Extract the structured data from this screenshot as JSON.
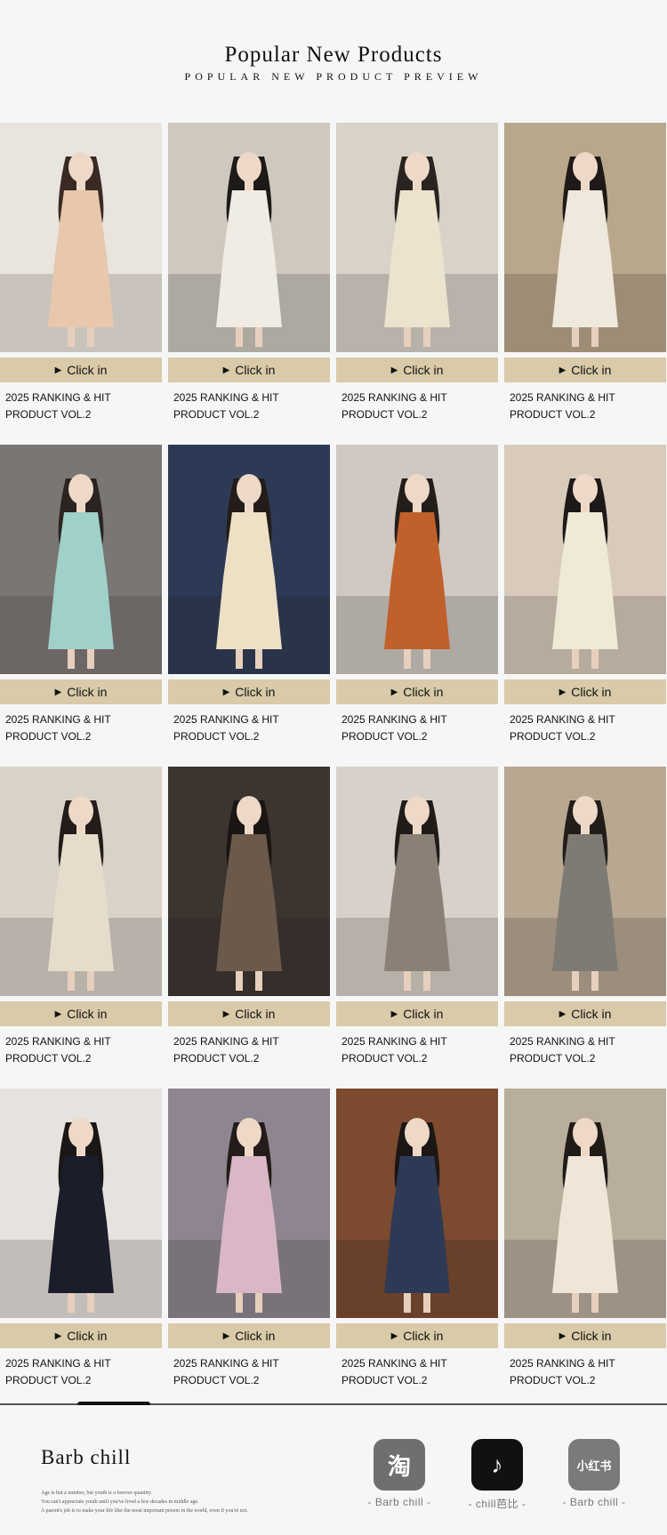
{
  "header": {
    "title": "Popular New Products",
    "subtitle": "POPULAR NEW PRODUCT PREVIEW"
  },
  "grid": {
    "button_label": "Click in",
    "items": [
      {
        "caption": "2025 RANKING & HIT PRODUCT VOL.2",
        "palette": [
          "#e9e4de",
          "#e8c7ac",
          "#3a2a24"
        ]
      },
      {
        "caption": "2025 RANKING & HIT PRODUCT VOL.2",
        "palette": [
          "#cfc8bf",
          "#f1ece3",
          "#1d1a18"
        ]
      },
      {
        "caption": "2025 RANKING & HIT PRODUCT VOL.2",
        "palette": [
          "#d8d2c8",
          "#ece3cf",
          "#2a2420"
        ]
      },
      {
        "caption": "2025 RANKING & HIT PRODUCT VOL.2",
        "palette": [
          "#b9a78c",
          "#efe8dc",
          "#1f1a17"
        ]
      },
      {
        "caption": "2025 RANKING & HIT PRODUCT VOL.2",
        "palette": [
          "#7a7673",
          "#9fd0c9",
          "#2b2421"
        ]
      },
      {
        "caption": "2025 RANKING & HIT PRODUCT VOL.2",
        "palette": [
          "#2c3a55",
          "#ede0c4",
          "#231c18"
        ]
      },
      {
        "caption": "2025 RANKING & HIT PRODUCT VOL.2",
        "palette": [
          "#cfc9c2",
          "#c0602b",
          "#241e1b"
        ]
      },
      {
        "caption": "2025 RANKING & HIT PRODUCT VOL.2",
        "palette": [
          "#d8cbbb",
          "#efe9d8",
          "#1d1918"
        ]
      },
      {
        "caption": "2025 RANKING & HIT PRODUCT VOL.2",
        "palette": [
          "#d9d2c8",
          "#e6dccb",
          "#231c19"
        ]
      },
      {
        "caption": "2025 RANKING & HIT PRODUCT VOL.2",
        "palette": [
          "#3b342f",
          "#6b5a4c",
          "#1b1614"
        ]
      },
      {
        "caption": "2025 RANKING & HIT PRODUCT VOL.2",
        "palette": [
          "#d7d1c9",
          "#8a8076",
          "#221c19"
        ]
      },
      {
        "caption": "2025 RANKING & HIT PRODUCT VOL.2",
        "palette": [
          "#b8a892",
          "#7e7a74",
          "#231d1a"
        ]
      },
      {
        "caption": "2025 RANKING & HIT PRODUCT VOL.2",
        "palette": [
          "#e6e3de",
          "#1b1d2b",
          "#1b1716"
        ]
      },
      {
        "caption": "2025 RANKING & HIT PRODUCT VOL.2",
        "palette": [
          "#8e8590",
          "#d9b7c6",
          "#231c1a"
        ]
      },
      {
        "caption": "2025 RANKING & HIT PRODUCT VOL.2",
        "palette": [
          "#7b4a2f",
          "#2e3a55",
          "#1c1715"
        ]
      },
      {
        "caption": "2025 RANKING & HIT PRODUCT VOL.2",
        "palette": [
          "#b9ad9c",
          "#efe6d7",
          "#211b18"
        ]
      }
    ]
  },
  "footer": {
    "brand": "Barb chill",
    "slogan_lines": [
      "Age is but a number, but youth is a forever quantity.",
      "You can't appreciate youth until you've lived a few decades in middle age.",
      "A parent's job is to make your life like the most important person in the world, even if you're not."
    ],
    "apps": [
      {
        "icon": "taobao-icon",
        "glyph": "淘",
        "label": "- Barb chill -",
        "color": "#6f6f6f"
      },
      {
        "icon": "tiktok-icon",
        "glyph": "♪",
        "label": "- chill芭比 -",
        "color": "#111111"
      },
      {
        "icon": "xiaohongshu-icon",
        "glyph": "小红书",
        "label": "- Barb chill -",
        "color": "#7a7a7a"
      }
    ]
  }
}
